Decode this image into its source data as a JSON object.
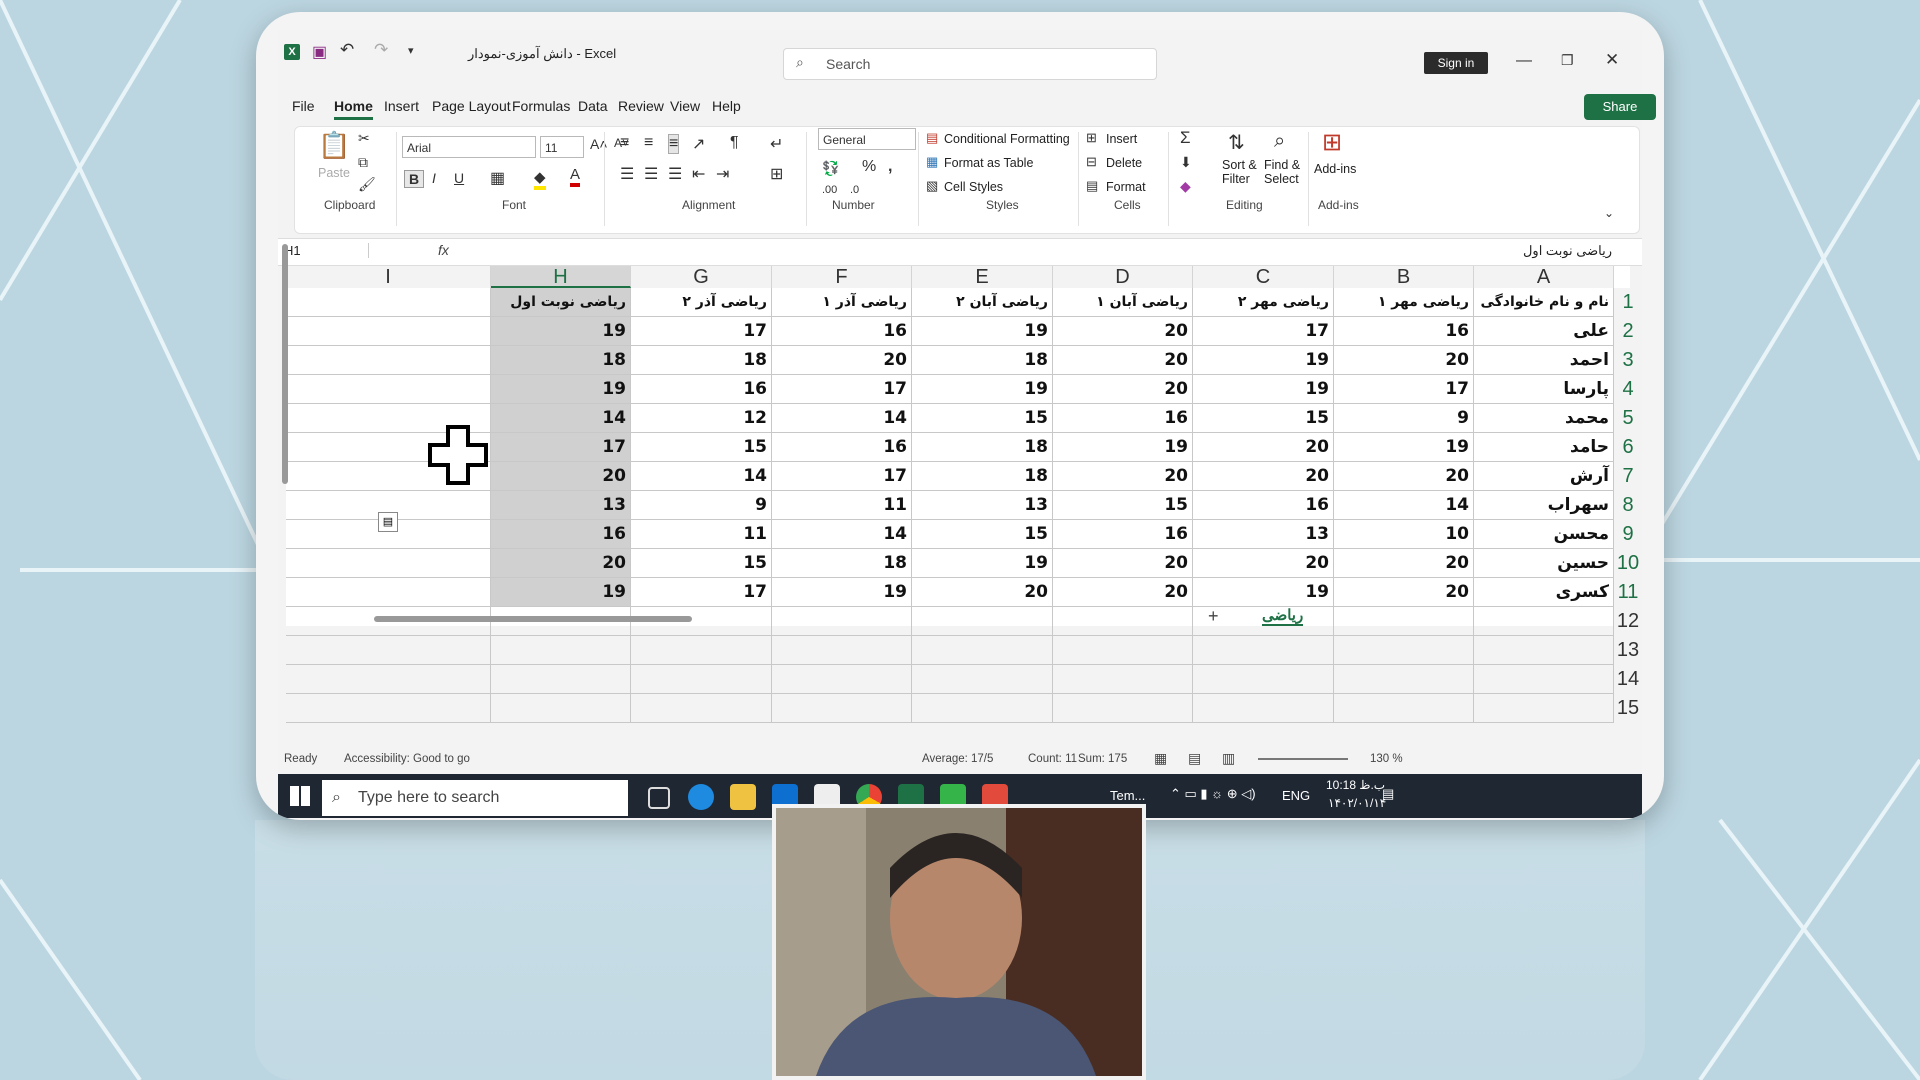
{
  "window": {
    "title": "دانش آموزی-نمودار  -  Excel",
    "search_placeholder": "Search",
    "sign_in": "Sign in",
    "share": "Share"
  },
  "menu": {
    "file": "File",
    "home": "Home",
    "insert": "Insert",
    "page_layout": "Page Layout",
    "formulas": "Formulas",
    "data": "Data",
    "review": "Review",
    "view": "View",
    "help": "Help"
  },
  "ribbon": {
    "clipboard": {
      "label": "Clipboard",
      "paste": "Paste"
    },
    "font": {
      "label": "Font",
      "name": "Arial",
      "size": "11"
    },
    "alignment": {
      "label": "Alignment"
    },
    "number": {
      "label": "Number",
      "format": "General"
    },
    "styles": {
      "label": "Styles",
      "conditional": "Conditional Formatting",
      "as_table": "Format as Table",
      "cell_styles": "Cell Styles"
    },
    "cells": {
      "label": "Cells",
      "insert": "Insert",
      "delete": "Delete",
      "format": "Format"
    },
    "editing": {
      "label": "Editing",
      "sort": "Sort &",
      "filter": "Filter",
      "find": "Find &",
      "select": "Select"
    },
    "addins": {
      "label": "Add-ins",
      "button": "Add-ins"
    }
  },
  "formula_bar": {
    "name_box": "H1",
    "fx": "fx",
    "content": "ریاضی نوبت اول"
  },
  "sheet": {
    "columns": [
      "A",
      "B",
      "C",
      "D",
      "E",
      "F",
      "G",
      "H",
      "I"
    ],
    "headers": [
      "نام و نام خانوادگی",
      "ریاضی مهر ۱",
      "ریاضی مهر ۲",
      "ریاضی آبان ۱",
      "ریاضی آبان ۲",
      "ریاضی آذر ۱",
      "ریاضی آذر ۲",
      "ریاضی نوبت اول"
    ],
    "rows": [
      [
        "علی",
        "16",
        "17",
        "20",
        "19",
        "16",
        "17",
        "19"
      ],
      [
        "احمد",
        "20",
        "19",
        "20",
        "18",
        "20",
        "18",
        "18"
      ],
      [
        "پارسا",
        "17",
        "19",
        "20",
        "19",
        "17",
        "16",
        "19"
      ],
      [
        "محمد",
        "9",
        "15",
        "16",
        "15",
        "14",
        "12",
        "14"
      ],
      [
        "حامد",
        "19",
        "20",
        "19",
        "18",
        "16",
        "15",
        "17"
      ],
      [
        "آرش",
        "20",
        "20",
        "20",
        "18",
        "17",
        "14",
        "20"
      ],
      [
        "سهراب",
        "14",
        "16",
        "15",
        "13",
        "11",
        "9",
        "13"
      ],
      [
        "محسن",
        "10",
        "13",
        "16",
        "15",
        "14",
        "11",
        "16"
      ],
      [
        "حسین",
        "20",
        "20",
        "20",
        "19",
        "18",
        "15",
        "20"
      ],
      [
        "کسری",
        "20",
        "19",
        "20",
        "20",
        "19",
        "17",
        "19"
      ]
    ],
    "row_numbers": [
      "1",
      "2",
      "3",
      "4",
      "5",
      "6",
      "7",
      "8",
      "9",
      "10",
      "11",
      "12",
      "13",
      "14",
      "15"
    ],
    "tab_name": "ریاضی"
  },
  "status": {
    "ready": "Ready",
    "accessibility": "Accessibility: Good to go",
    "average": "Average: 17/5",
    "count": "Count: 11",
    "sum": "Sum: 175",
    "zoom": "130 %"
  },
  "taskbar": {
    "search": "Type here to search",
    "weather": "Tem...",
    "lang": "ENG",
    "time": "10:18 ب.ظ",
    "date": "۱۴۰۲/۰۱/۱۴"
  }
}
